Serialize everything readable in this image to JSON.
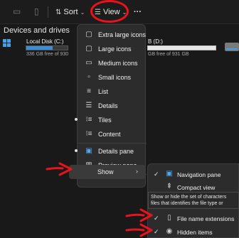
{
  "toolbar": {
    "sort_label": "Sort",
    "view_label": "View",
    "more_label": "···"
  },
  "section": {
    "title": "Devices and drives"
  },
  "drives": [
    {
      "name": "Local Disk (C:)",
      "free_text": "336 GB free of 930",
      "used_fraction": 0.64
    },
    {
      "name": "B (D:)",
      "free_text": "GB free of 931 GB",
      "used_fraction": 0.0
    }
  ],
  "view_menu": {
    "items": [
      {
        "label": "Extra large icons",
        "icon": "extra-large-icons-icon",
        "selected": false
      },
      {
        "label": "Large icons",
        "icon": "large-icons-icon",
        "selected": false
      },
      {
        "label": "Medium icons",
        "icon": "medium-icons-icon",
        "selected": false
      },
      {
        "label": "Small icons",
        "icon": "small-icons-icon",
        "selected": false
      },
      {
        "label": "List",
        "icon": "list-icon",
        "selected": false
      },
      {
        "label": "Details",
        "icon": "details-icon",
        "selected": false
      },
      {
        "label": "Tiles",
        "icon": "tiles-icon",
        "selected": true
      },
      {
        "label": "Content",
        "icon": "content-icon",
        "selected": false
      },
      {
        "label": "Details pane",
        "icon": "details-pane-icon",
        "selected": true
      },
      {
        "label": "Preview pane",
        "icon": "preview-pane-icon",
        "selected": false
      }
    ],
    "show_label": "Show"
  },
  "show_submenu": {
    "items": [
      {
        "label": "Navigation pane",
        "checked": true
      },
      {
        "label": "Compact view",
        "checked": false
      },
      {
        "label": "File name extensions",
        "checked": true
      },
      {
        "label": "Hidden items",
        "checked": true
      }
    ]
  },
  "tooltip": {
    "line1": "Show or hide the set of characters",
    "line2": "files that identifies the file type or"
  },
  "colors": {
    "annotation_red": "#e8131b",
    "drive_bar": "#3b8ed6",
    "background": "#191919",
    "menu_bg": "#2c2c2c"
  }
}
